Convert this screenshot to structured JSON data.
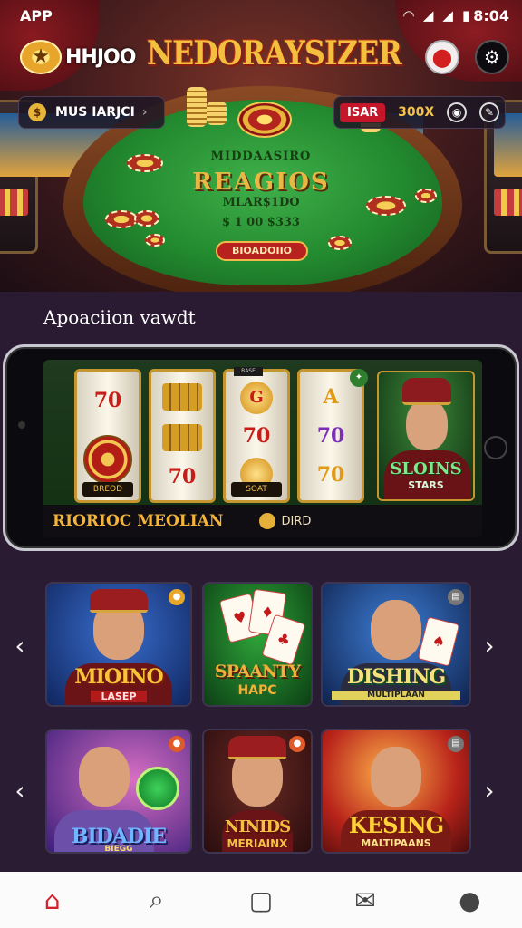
{
  "status_bar": {
    "app_label": "APP",
    "time": "8:04",
    "icons": [
      "wifi-icon",
      "signal-icon",
      "signal-icon",
      "battery-icon"
    ]
  },
  "header": {
    "logo_text": "HHJOO",
    "brand_title": "NEDORAYSIZER",
    "profile_icon": "profile-badge-icon",
    "settings_icon": "gear-icon"
  },
  "balance_pill": {
    "label": "MUS IARJCI",
    "icon": "coin-icon"
  },
  "top_right_pill": {
    "red_label": "ISAR",
    "gold_label": "300X",
    "icons": [
      "chip-icon",
      "edit-icon"
    ]
  },
  "table": {
    "line1": "MIDDAASIRO",
    "line2": "REAGIOS",
    "line3": "MLAR$1DO",
    "line4": "$ 1 00  $333",
    "button_label": "BIOADOIIO"
  },
  "featured": {
    "section_title": "Apoaciion vawdt",
    "reel_tag": "BASE",
    "reel_label_1": "BREOD",
    "reel_label_3": "SOAT",
    "symbols": {
      "reel1": [
        "70",
        "wheel"
      ],
      "reel2": [
        "drum",
        "drum",
        "70"
      ],
      "reel3": [
        "G",
        "70",
        "coin"
      ],
      "reel4": [
        "A",
        "70",
        "70"
      ]
    },
    "character_title": "SLOINS",
    "character_sub": "STARS",
    "bar_title": "RIORIOC MEOLIAN",
    "bar_value": "DIRD"
  },
  "games": [
    {
      "title": "MIOINO",
      "sub": "LASEP",
      "theme": "blue"
    },
    {
      "title": "SPAANTY",
      "sub": "HAPC",
      "theme": "green"
    },
    {
      "title": "DISHING",
      "sub": "MULTIPLAAN",
      "theme": "blue-gold"
    },
    {
      "title": "BIDADIE",
      "sub": "BIEGG",
      "theme": "purple"
    },
    {
      "title": "NINIDS",
      "sub": "MERIAINX",
      "theme": "dark-red"
    },
    {
      "title": "KESING",
      "sub": "MALTIPAANS",
      "theme": "orange"
    }
  ],
  "bottom_nav": {
    "items": [
      {
        "icon": "home-icon",
        "active": true
      },
      {
        "icon": "search-icon",
        "active": false
      },
      {
        "icon": "chat-icon",
        "active": false
      },
      {
        "icon": "inbox-icon",
        "active": false
      },
      {
        "icon": "user-icon",
        "active": false
      }
    ]
  },
  "colors": {
    "accent": "#d51f2a",
    "gold": "#f2bf3e",
    "background": "#2a1c33"
  }
}
